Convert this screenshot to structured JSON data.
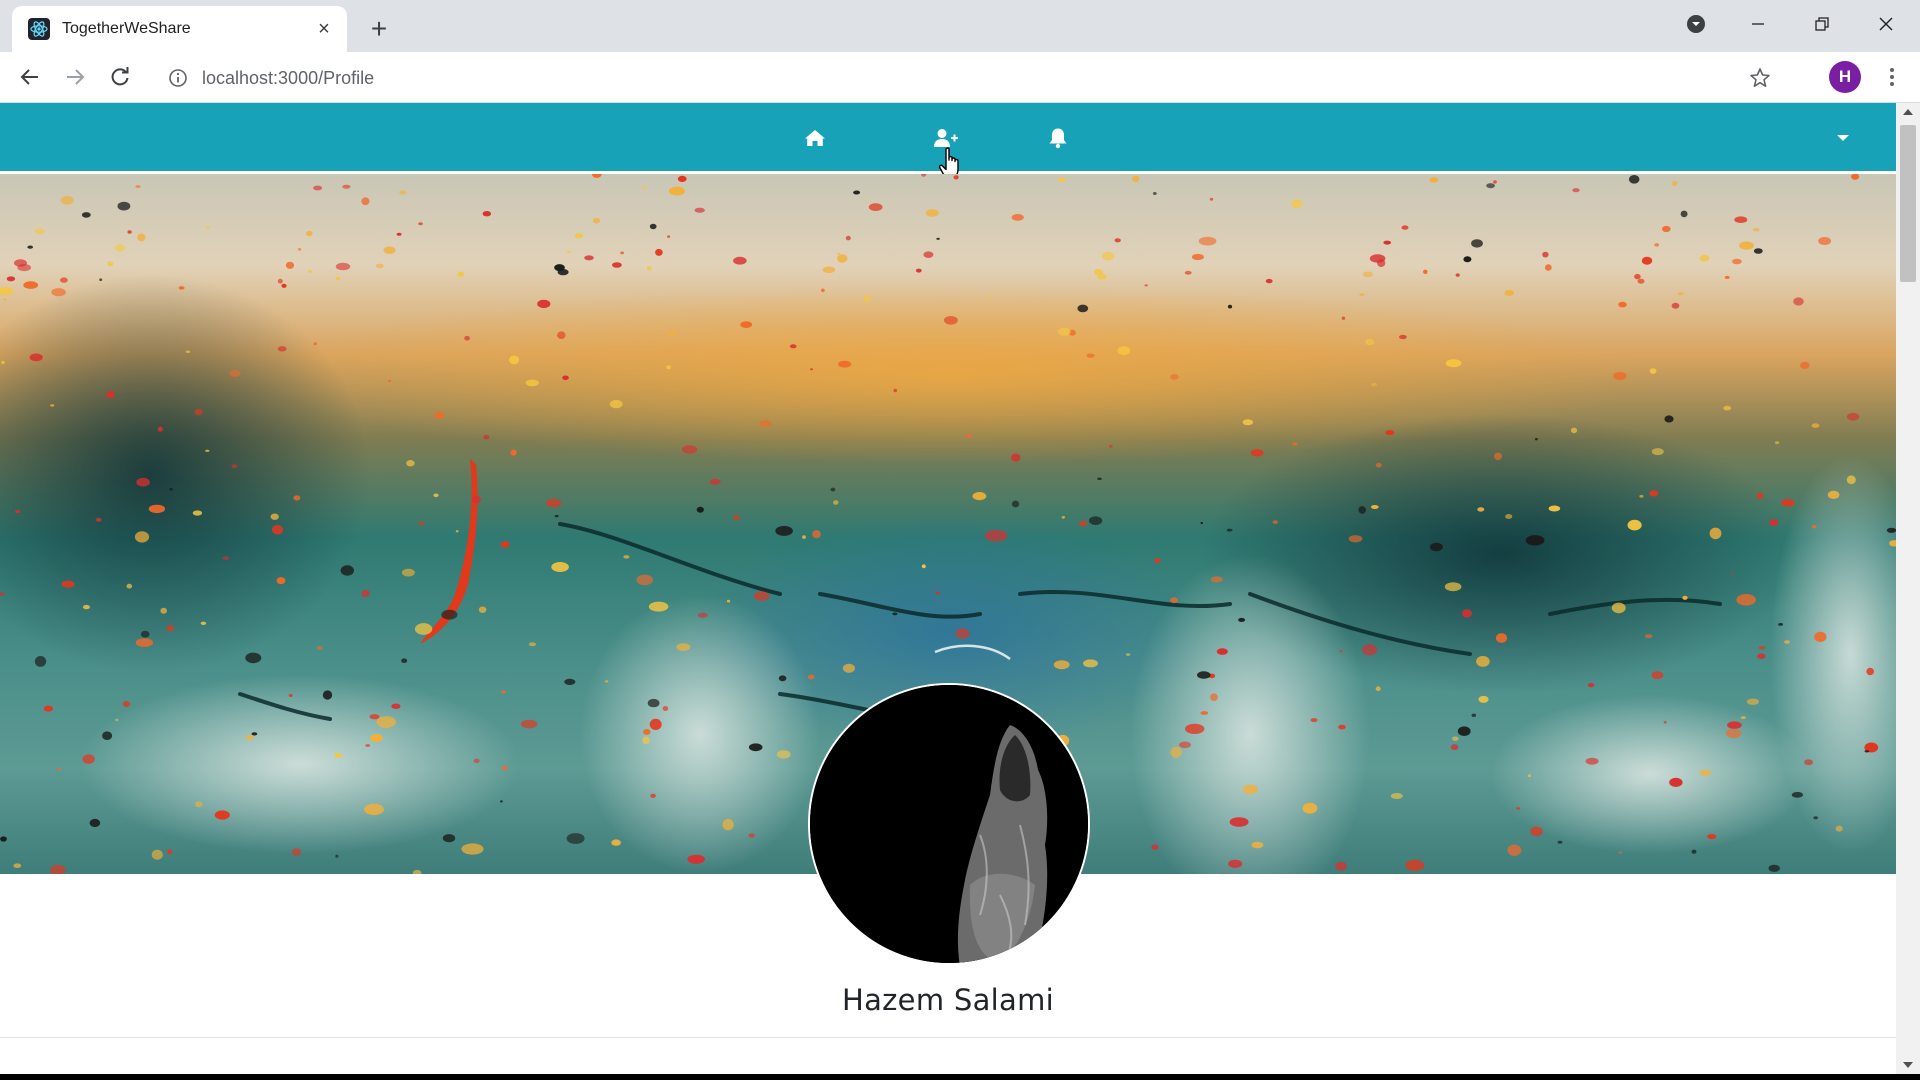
{
  "browser": {
    "tab_title": "TogetherWeShare",
    "tab_close": "×",
    "new_tab": "+",
    "url": "localhost:3000/Profile",
    "profile_initial": "H"
  },
  "navbar": {
    "color": "#17a2b8",
    "icons": [
      "home-icon",
      "add-user-icon",
      "bell-icon",
      "caret-down-icon"
    ]
  },
  "profile": {
    "name": "Hazem Salami"
  }
}
